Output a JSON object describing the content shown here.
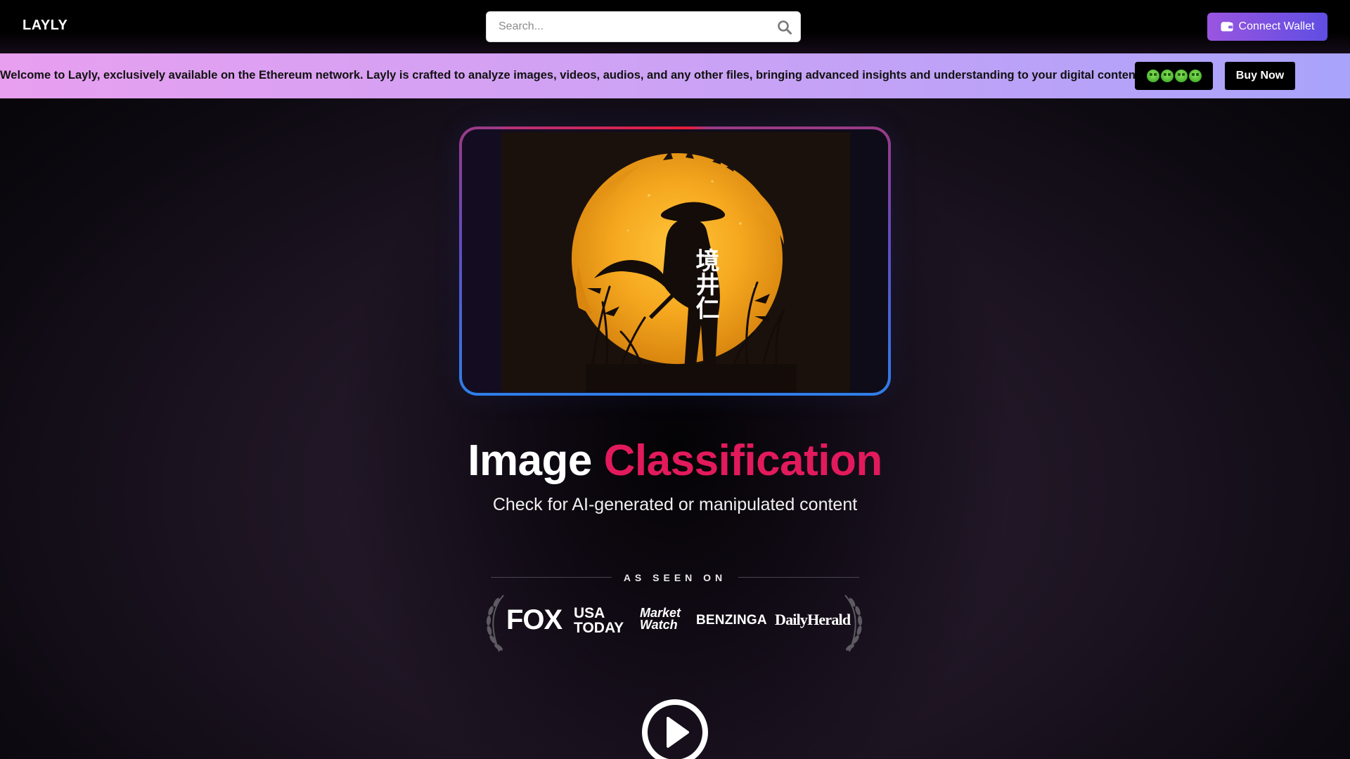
{
  "header": {
    "logo": "LAYLY",
    "search_placeholder": "Search...",
    "connect_wallet_label": "Connect Wallet",
    "icons": {
      "search": "search-icon",
      "wallet": "wallet-icon"
    }
  },
  "banner": {
    "text": "Welcome to Layly, exclusively available on the Ethereum network. Layly is crafted to analyze images, videos, audios, and any other files, bringing advanced insights and understanding to your digital content.",
    "emojis": "🤑🤑🤑🤑",
    "buy_label": "Buy Now"
  },
  "hero": {
    "artwork_caption": "境井仁",
    "title_main": "Image ",
    "title_accent": "Classification",
    "subtitle": "Check for AI-generated or manipulated content"
  },
  "press": {
    "heading": "AS SEEN ON",
    "outlets": [
      {
        "name": "FOX"
      },
      {
        "line1": "USA",
        "line2": "TODAY"
      },
      {
        "line1": "Market",
        "line2": "Watch"
      },
      {
        "name": "BENZINGA"
      },
      {
        "name": "DailyHerald"
      }
    ]
  },
  "colors": {
    "accent": "#e21a5c",
    "wallet_gradient_start": "#9a55e0",
    "wallet_gradient_end": "#5f4ee2",
    "banner_start": "#e89ff0",
    "banner_end": "#a9a3fb",
    "frame_blue": "#2f7ee8"
  }
}
